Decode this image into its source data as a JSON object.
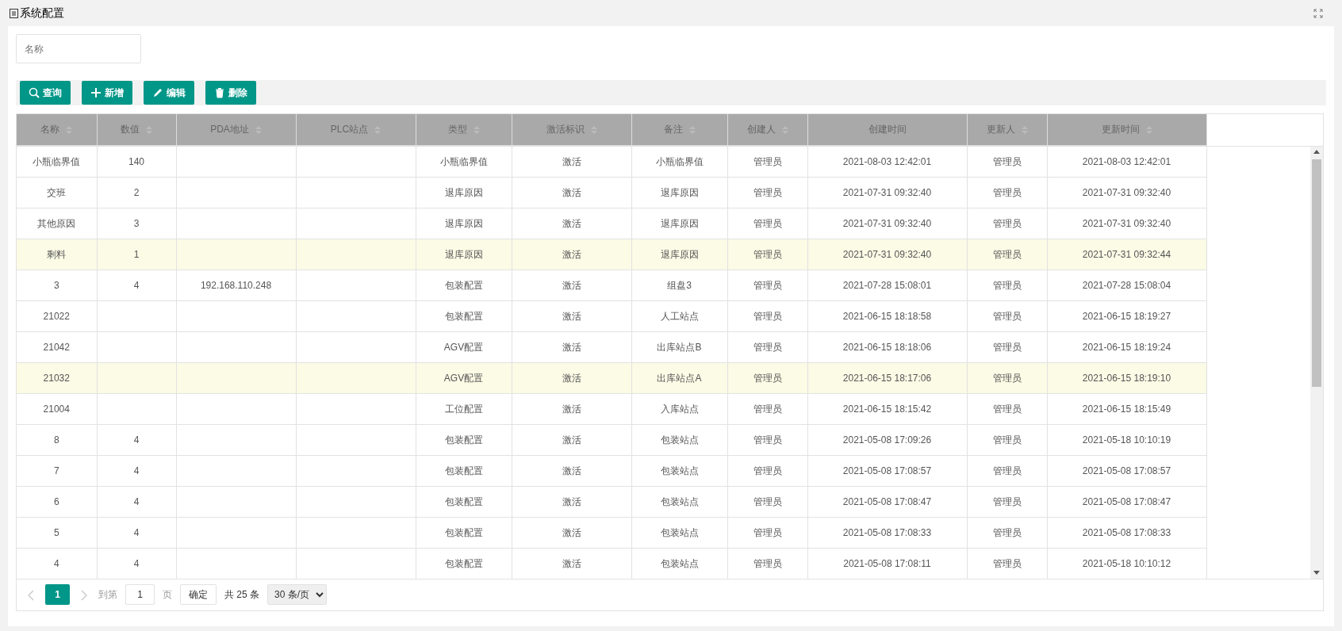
{
  "panel": {
    "title": "系统配置"
  },
  "search": {
    "placeholder": "名称"
  },
  "toolbar": [
    {
      "label": "查询",
      "kind": "search"
    },
    {
      "label": "新增",
      "kind": "add"
    },
    {
      "label": "编辑",
      "kind": "edit"
    },
    {
      "label": "删除",
      "kind": "delete"
    }
  ],
  "table": {
    "columns": [
      {
        "label": "名称",
        "sortable": true
      },
      {
        "label": "数值",
        "sortable": true
      },
      {
        "label": "PDA地址",
        "sortable": true
      },
      {
        "label": "PLC站点",
        "sortable": true
      },
      {
        "label": "类型",
        "sortable": true
      },
      {
        "label": "激活标识",
        "sortable": true
      },
      {
        "label": "备注",
        "sortable": true
      },
      {
        "label": "创建人",
        "sortable": true
      },
      {
        "label": "创建时间",
        "sortable": false
      },
      {
        "label": "更新人",
        "sortable": true
      },
      {
        "label": "更新时间",
        "sortable": true
      }
    ],
    "rows": [
      {
        "selected": false,
        "cells": [
          "小瓶临界值",
          "140",
          "",
          "",
          "小瓶临界值",
          "激活",
          "小瓶临界值",
          "管理员",
          "2021-08-03 12:42:01",
          "管理员",
          "2021-08-03 12:42:01"
        ]
      },
      {
        "selected": false,
        "cells": [
          "交班",
          "2",
          "",
          "",
          "退库原因",
          "激活",
          "退库原因",
          "管理员",
          "2021-07-31 09:32:40",
          "管理员",
          "2021-07-31 09:32:40"
        ]
      },
      {
        "selected": false,
        "cells": [
          "其他原因",
          "3",
          "",
          "",
          "退库原因",
          "激活",
          "退库原因",
          "管理员",
          "2021-07-31 09:32:40",
          "管理员",
          "2021-07-31 09:32:40"
        ]
      },
      {
        "selected": true,
        "cells": [
          "剩料",
          "1",
          "",
          "",
          "退库原因",
          "激活",
          "退库原因",
          "管理员",
          "2021-07-31 09:32:40",
          "管理员",
          "2021-07-31 09:32:44"
        ]
      },
      {
        "selected": false,
        "cells": [
          "3",
          "4",
          "192.168.110.248",
          "",
          "包装配置",
          "激活",
          "组盘3",
          "管理员",
          "2021-07-28 15:08:01",
          "管理员",
          "2021-07-28 15:08:04"
        ]
      },
      {
        "selected": false,
        "cells": [
          "21022",
          "",
          "",
          "",
          "包装配置",
          "激活",
          "人工站点",
          "管理员",
          "2021-06-15 18:18:58",
          "管理员",
          "2021-06-15 18:19:27"
        ]
      },
      {
        "selected": false,
        "cells": [
          "21042",
          "",
          "",
          "",
          "AGV配置",
          "激活",
          "出库站点B",
          "管理员",
          "2021-06-15 18:18:06",
          "管理员",
          "2021-06-15 18:19:24"
        ]
      },
      {
        "selected": true,
        "cells": [
          "21032",
          "",
          "",
          "",
          "AGV配置",
          "激活",
          "出库站点A",
          "管理员",
          "2021-06-15 18:17:06",
          "管理员",
          "2021-06-15 18:19:10"
        ]
      },
      {
        "selected": false,
        "cells": [
          "21004",
          "",
          "",
          "",
          "工位配置",
          "激活",
          "入库站点",
          "管理员",
          "2021-06-15 18:15:42",
          "管理员",
          "2021-06-15 18:15:49"
        ]
      },
      {
        "selected": false,
        "cells": [
          "8",
          "4",
          "",
          "",
          "包装配置",
          "激活",
          "包装站点",
          "管理员",
          "2021-05-08 17:09:26",
          "管理员",
          "2021-05-18 10:10:19"
        ]
      },
      {
        "selected": false,
        "cells": [
          "7",
          "4",
          "",
          "",
          "包装配置",
          "激活",
          "包装站点",
          "管理员",
          "2021-05-08 17:08:57",
          "管理员",
          "2021-05-08 17:08:57"
        ]
      },
      {
        "selected": false,
        "cells": [
          "6",
          "4",
          "",
          "",
          "包装配置",
          "激活",
          "包装站点",
          "管理员",
          "2021-05-08 17:08:47",
          "管理员",
          "2021-05-08 17:08:47"
        ]
      },
      {
        "selected": false,
        "cells": [
          "5",
          "4",
          "",
          "",
          "包装配置",
          "激活",
          "包装站点",
          "管理员",
          "2021-05-08 17:08:33",
          "管理员",
          "2021-05-08 17:08:33"
        ]
      },
      {
        "selected": false,
        "cells": [
          "4",
          "4",
          "",
          "",
          "包装配置",
          "激活",
          "包装站点",
          "管理员",
          "2021-05-08 17:08:11",
          "管理员",
          "2021-05-18 10:10:12"
        ]
      }
    ]
  },
  "pagination": {
    "pages": [
      {
        "label": "1",
        "selected": true
      }
    ],
    "goto_label": "到第",
    "goto_value": "1",
    "page_unit": "页",
    "confirm": "确定",
    "total": "共 25 条",
    "page_size": "30 条/页"
  }
}
